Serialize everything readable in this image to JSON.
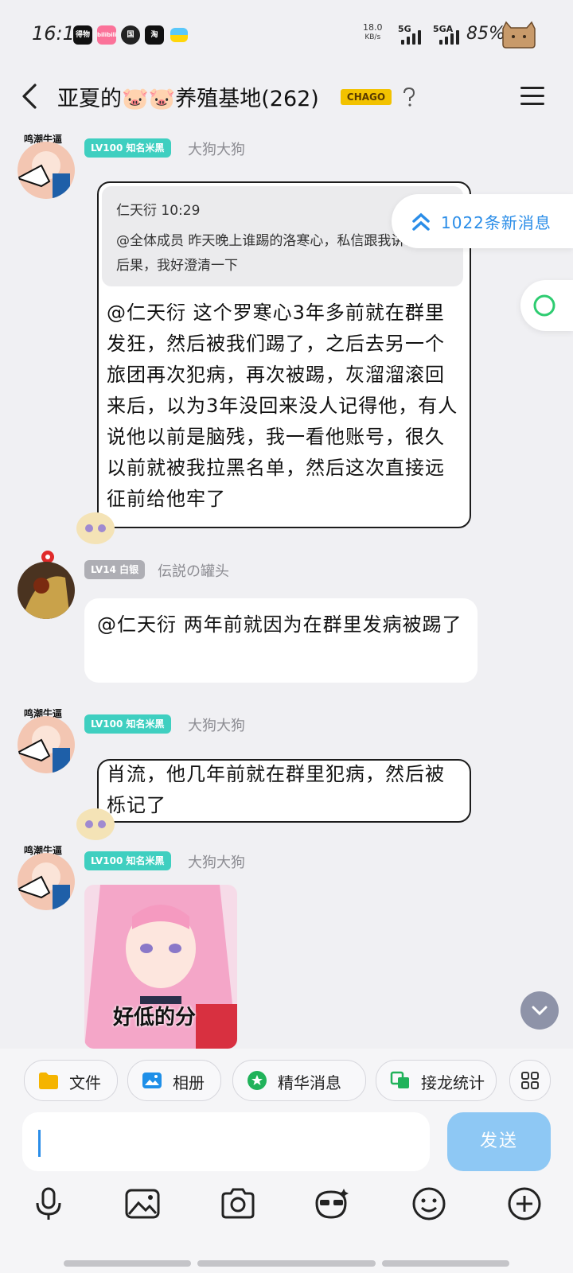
{
  "status": {
    "time": "16:15",
    "net_speed": "18.0",
    "net_unit": "KB/s",
    "sig1": "5G",
    "sig2": "5GA",
    "battery": "85%",
    "apps": [
      "得物",
      "bilibili",
      "国",
      "淘"
    ]
  },
  "header": {
    "title": "亚夏的🐷🐷养殖基地(262)",
    "badge": "CHAGO"
  },
  "new_messages": "1022条新消息",
  "messages": [
    {
      "avatar_tag": "鸣潮牛逼",
      "level": "LV100 知名米黑",
      "nick": "大狗大狗",
      "quote_head": "仁天衍 10:29",
      "quote_body": "@全体成员 昨天晚上谁踢的洛寒心，私信跟我讲讲前因后果，我好澄清一下",
      "text": "@仁天衍 这个罗寒心3年多前就在群里发狂，然后被我们踢了，之后去另一个旅团再次犯病，再次被踢，灰溜溜滚回来后，以为3年没回来没人记得他，有人说他以前是脑残，我一看他账号，很久以前就被我拉黑名单，然后这次直接远征前给他牢了"
    },
    {
      "level": "LV14 白银",
      "nick": "伝説の罐头",
      "text": "@仁天衍 两年前就因为在群里发病被踢了"
    },
    {
      "avatar_tag": "鸣潮牛逼",
      "level": "LV100 知名米黑",
      "nick": "大狗大狗",
      "text": "肖流，他几年前就在群里犯病，然后被栎记了"
    },
    {
      "avatar_tag": "鸣潮牛逼",
      "level": "LV100 知名米黑",
      "nick": "大狗大狗",
      "image_caption": "好低的分"
    }
  ],
  "shortcuts": [
    "文件",
    "相册",
    "精华消息",
    "接龙统计"
  ],
  "composer": {
    "placeholder": "",
    "send": "发送"
  },
  "colors": {
    "accent": "#2a8de8",
    "level_teal": "#3fcfc0",
    "send_disabled": "#8ec8f4"
  },
  "icons": [
    "back-icon",
    "help-icon",
    "menu-icon",
    "double-chevron-up-icon",
    "ring-icon",
    "chevron-down-icon",
    "folder-icon",
    "image-icon",
    "star-icon",
    "relay-icon",
    "apps-grid-icon",
    "microphone-icon",
    "picture-icon",
    "camera-icon",
    "sticker-icon",
    "emoji-icon",
    "plus-circle-icon"
  ]
}
